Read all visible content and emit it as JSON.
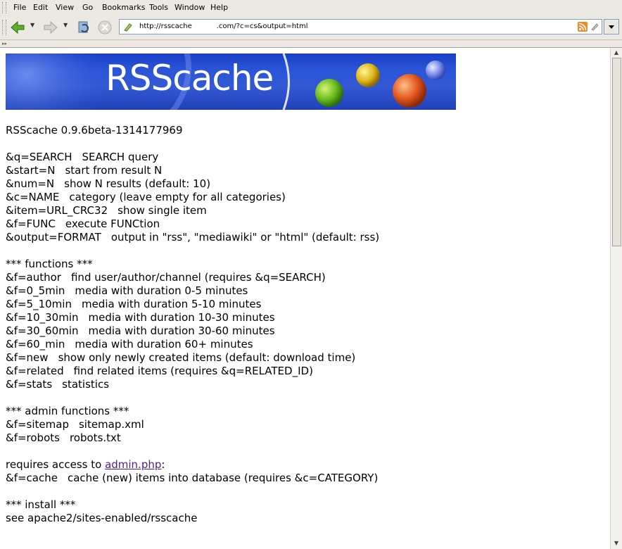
{
  "menu": {
    "items": [
      {
        "label": "File"
      },
      {
        "label": "Edit"
      },
      {
        "label": "View"
      },
      {
        "label": "Go"
      },
      {
        "label": "Bookmarks"
      },
      {
        "label": "Tools"
      },
      {
        "label": "Window"
      },
      {
        "label": "Help"
      }
    ]
  },
  "toolbar": {
    "url": "http://rsscache           .com/?c=cs&output=html"
  },
  "banner": {
    "title": "RSScache"
  },
  "page": {
    "version": "RSScache 0.9.6beta-1314177969",
    "params": [
      {
        "key": "&q=SEARCH",
        "desc": "SEARCH query"
      },
      {
        "key": "&start=N",
        "desc": "start from result N"
      },
      {
        "key": "&num=N",
        "desc": "show N results (default: 10)"
      },
      {
        "key": "&c=NAME",
        "desc": "category (leave empty for all categories)"
      },
      {
        "key": "&item=URL_CRC32",
        "desc": "show single item"
      },
      {
        "key": "&f=FUNC",
        "desc": "execute FUNCtion"
      },
      {
        "key": "&output=FORMAT",
        "desc": "output in \"rss\", \"mediawiki\" or \"html\" (default: rss)"
      }
    ],
    "functions_header": "*** functions ***",
    "functions": [
      {
        "key": "&f=author",
        "desc": "find user/author/channel (requires &q=SEARCH)"
      },
      {
        "key": "&f=0_5min",
        "desc": "media with duration 0-5 minutes"
      },
      {
        "key": "&f=5_10min",
        "desc": "media with duration 5-10 minutes"
      },
      {
        "key": "&f=10_30min",
        "desc": "media with duration 10-30 minutes"
      },
      {
        "key": "&f=30_60min",
        "desc": "media with duration 30-60 minutes"
      },
      {
        "key": "&f=60_min",
        "desc": "media with duration 60+ minutes"
      },
      {
        "key": "&f=new",
        "desc": "show only newly created items (default: download time)"
      },
      {
        "key": "&f=related",
        "desc": "find related items (requires &q=RELATED_ID)"
      },
      {
        "key": "&f=stats",
        "desc": "statistics"
      }
    ],
    "admin_header": "*** admin functions ***",
    "admin": [
      {
        "key": "&f=sitemap",
        "desc": "sitemap.xml"
      },
      {
        "key": "&f=robots",
        "desc": "robots.txt"
      }
    ],
    "requires_prefix": "requires access to ",
    "requires_link": "admin.php",
    "requires_suffix": ":",
    "cache": {
      "key": "&f=cache",
      "desc": "cache (new) items into database (requires &c=CATEGORY)"
    },
    "install_header": "*** install ***",
    "install_text": "see apache2/sites-enabled/rsscache"
  },
  "colors": {
    "chrome": "#ece9e2",
    "link": "#551a8b",
    "banner_blue": "#2b55d8"
  }
}
